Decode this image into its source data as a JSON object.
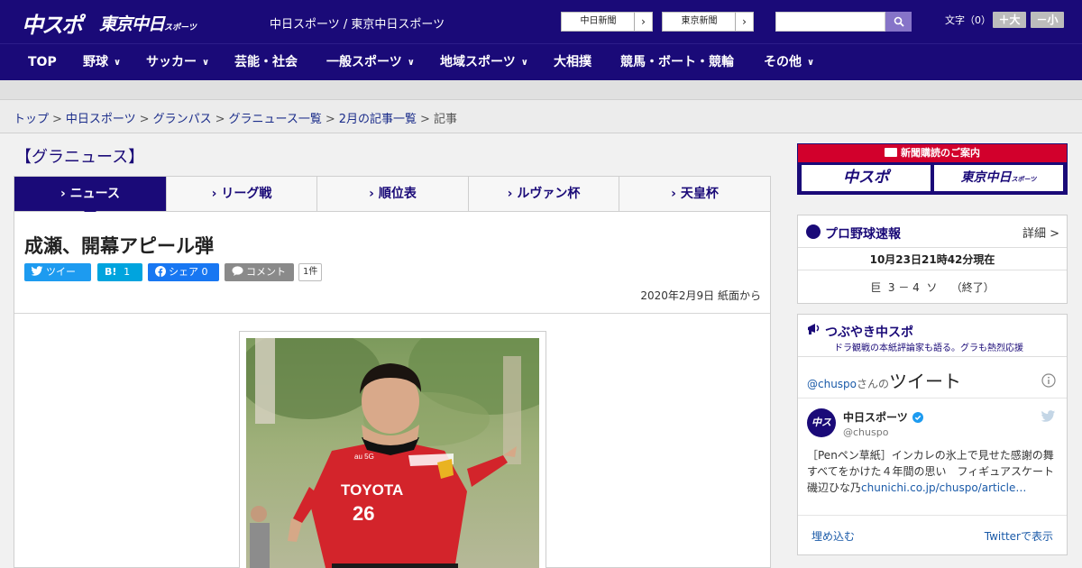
{
  "header": {
    "logo_main": "中スポ",
    "logo_sub": "東京中日",
    "logo_sub_small": "スポーツ",
    "site_title": "中日スポーツ / 東京中日スポーツ",
    "paper_buttons": [
      "中日新聞",
      "東京新聞"
    ],
    "arrow": "›",
    "fontsize_label": "文字（0）",
    "font_larger": "＋大",
    "font_smaller": "－小"
  },
  "nav": [
    {
      "label": "TOP",
      "dropdown": false
    },
    {
      "label": "野球",
      "dropdown": true
    },
    {
      "label": "サッカー",
      "dropdown": true
    },
    {
      "label": "芸能・社会",
      "dropdown": false
    },
    {
      "label": "一般スポーツ",
      "dropdown": true
    },
    {
      "label": "地域スポーツ",
      "dropdown": true
    },
    {
      "label": "大相撲",
      "dropdown": false
    },
    {
      "label": "競馬・ボート・競輪",
      "dropdown": false
    },
    {
      "label": "その他",
      "dropdown": true
    }
  ],
  "breadcrumb": [
    "トップ",
    "中日スポーツ",
    "グランパス",
    "グラニュース一覧",
    "2月の記事一覧"
  ],
  "breadcrumb_current": "記事",
  "breadcrumb_sep": ">",
  "section_title": "【グラニュース】",
  "tabs": [
    "ニュース",
    "リーグ戦",
    "順位表",
    "ルヴァン杯",
    "天皇杯"
  ],
  "tab_prefix": "›",
  "article": {
    "headline": "成瀬、開幕アピール弾",
    "share": {
      "tweet": "ツイート",
      "hatena": "B!",
      "hatena_count": "1",
      "facebook": "シェア",
      "facebook_count": "0",
      "comment": "コメント",
      "comment_count": "1件"
    },
    "dateline": "2020年2月9日 紙面から"
  },
  "jersey": {
    "sponsor": "TOYOTA",
    "number": "26",
    "kit": "au 5G"
  },
  "sidebar": {
    "ad_title": "新聞購読のご案内",
    "ad_buttons": [
      "中スポ",
      "東京中日"
    ],
    "ad_small": "スポーツ",
    "baseball": {
      "title": "プロ野球速報",
      "detail": "詳細 >",
      "timestamp": "10月23日21時42分現在",
      "score": "巨  3 － 4  ソ    （終了）"
    },
    "tweets": {
      "title": "つぶやき中スポ",
      "subtitle": "ドラ観戦の本紙評論家も語る。グラも熱烈応援",
      "handle": "@chuspo",
      "handle_suffix": "さんの",
      "tweet_heading": "ツイート",
      "author_name": "中日スポーツ",
      "author_handle": "@chuspo",
      "tweet_text": "［Penペン草紙］インカレの氷上で見せた感謝の舞　すべてをかけた４年間の思い　フィギュアスケート　磯辺ひな乃",
      "tweet_link": "chunichi.co.jp/chuspo/article…",
      "embed": "埋め込む",
      "view_on_twitter": "Twitterで表示"
    }
  },
  "colors": {
    "brand": "#1a0a78",
    "accent_red": "#d2002c",
    "twitter": "#1d9bf0",
    "facebook": "#1877f2",
    "hatena": "#00a4de"
  }
}
